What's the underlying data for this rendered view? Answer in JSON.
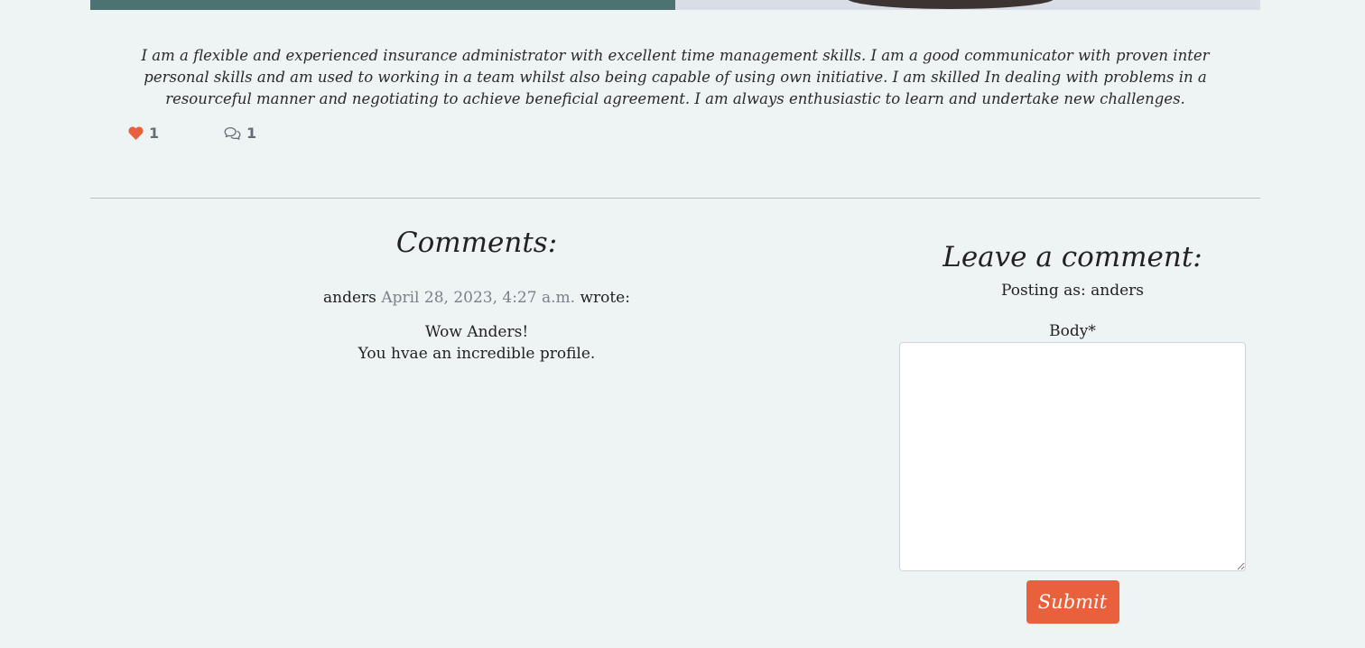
{
  "post": {
    "bio": "I am a flexible and experienced insurance administrator with excellent time management skills. I am a good communicator with proven inter personal skills and am used to working in a team whilst also being capable of using own initiative. I am skilled In dealing with problems in a resourceful manner and negotiating to achieve beneficial agreement. I am always enthusiastic to learn and undertake new challenges.",
    "likes_count": "1",
    "comments_count": "1"
  },
  "comments": {
    "title": "Comments:",
    "items": [
      {
        "author": "anders",
        "date": "April 28, 2023, 4:27 a.m.",
        "wrote": "wrote:",
        "body_line1": "Wow Anders!",
        "body_line2": "You hvae an incredible profile."
      }
    ]
  },
  "comment_form": {
    "title": "Leave a comment:",
    "posting_as": "Posting as: anders",
    "body_label": "Body*",
    "body_value": "",
    "submit_label": "Submit"
  },
  "colors": {
    "background": "#eef3f3",
    "accent": "#e8613c",
    "hero_left": "#4d7272",
    "muted_text": "#7a8189"
  },
  "icons": {
    "like": "heart-icon",
    "comment": "comment-icon"
  }
}
